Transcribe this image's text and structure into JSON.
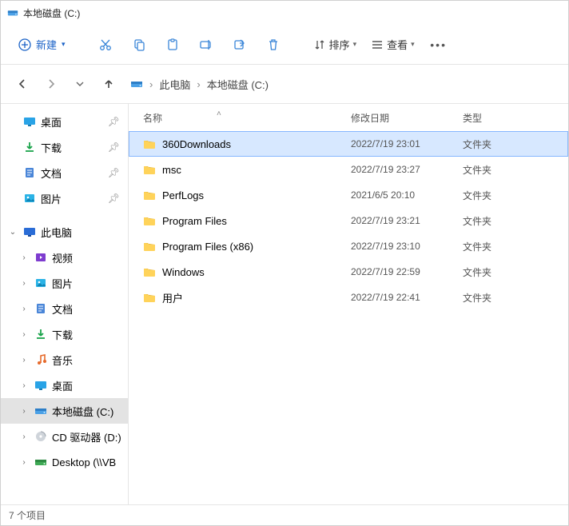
{
  "window": {
    "title": "本地磁盘 (C:)"
  },
  "toolbar": {
    "new_label": "新建",
    "sort_label": "排序",
    "view_label": "查看"
  },
  "breadcrumb": {
    "items": [
      "此电脑",
      "本地磁盘 (C:)"
    ]
  },
  "sidebar": {
    "quick": [
      {
        "label": "桌面",
        "icon": "desktop",
        "pinned": true
      },
      {
        "label": "下载",
        "icon": "download",
        "pinned": true
      },
      {
        "label": "文档",
        "icon": "document",
        "pinned": true
      },
      {
        "label": "图片",
        "icon": "picture",
        "pinned": true
      }
    ],
    "thispc_label": "此电脑",
    "thispc_children": [
      {
        "label": "视频",
        "icon": "video"
      },
      {
        "label": "图片",
        "icon": "picture"
      },
      {
        "label": "文档",
        "icon": "document"
      },
      {
        "label": "下载",
        "icon": "download"
      },
      {
        "label": "音乐",
        "icon": "music"
      },
      {
        "label": "桌面",
        "icon": "desktop"
      },
      {
        "label": "本地磁盘 (C:)",
        "icon": "drive",
        "selected": true
      },
      {
        "label": "CD 驱动器 (D:)",
        "icon": "cd"
      },
      {
        "label": "Desktop (\\\\VB",
        "icon": "netdrive"
      }
    ]
  },
  "columns": {
    "name": "名称",
    "date": "修改日期",
    "type": "类型"
  },
  "files": [
    {
      "name": "360Downloads",
      "date": "2022/7/19 23:01",
      "type": "文件夹",
      "selected": true
    },
    {
      "name": "msc",
      "date": "2022/7/19 23:27",
      "type": "文件夹"
    },
    {
      "name": "PerfLogs",
      "date": "2021/6/5 20:10",
      "type": "文件夹"
    },
    {
      "name": "Program Files",
      "date": "2022/7/19 23:21",
      "type": "文件夹"
    },
    {
      "name": "Program Files (x86)",
      "date": "2022/7/19 23:10",
      "type": "文件夹"
    },
    {
      "name": "Windows",
      "date": "2022/7/19 22:59",
      "type": "文件夹"
    },
    {
      "name": "用户",
      "date": "2022/7/19 22:41",
      "type": "文件夹"
    }
  ],
  "status": "7 个项目"
}
